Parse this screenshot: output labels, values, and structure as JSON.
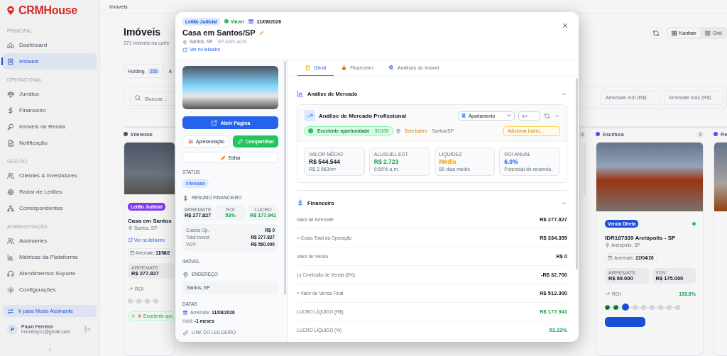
{
  "brand": {
    "name": "CRMHouse"
  },
  "sidebar": {
    "sections": [
      {
        "title": "PRINCIPAL",
        "items": [
          {
            "label": "Dashboard",
            "selected": false
          },
          {
            "label": "Imóveis",
            "selected": true
          }
        ]
      },
      {
        "title": "OPERACIONAL",
        "items": [
          {
            "label": "Jurídico",
            "selected": false
          },
          {
            "label": "Financeiro",
            "selected": false
          },
          {
            "label": "Imóveis de Renda",
            "selected": false
          },
          {
            "label": "Notificação",
            "selected": false
          }
        ]
      },
      {
        "title": "GESTÃO",
        "items": [
          {
            "label": "Clientes & Investidores",
            "selected": false
          },
          {
            "label": "Radar de Leilões",
            "selected": false
          },
          {
            "label": "Correspondentes",
            "selected": false
          }
        ]
      },
      {
        "title": "ADMINISTRAÇÃO",
        "items": [
          {
            "label": "Assinantes",
            "selected": false
          },
          {
            "label": "Métricas da Plataforma",
            "selected": false
          },
          {
            "label": "Atendimentos Suporte",
            "selected": false
          },
          {
            "label": "Configurações",
            "selected": false
          }
        ]
      }
    ],
    "mode_button": "Ir para Modo Assinante",
    "user": {
      "initial": "P",
      "name": "Paulo Ferreira",
      "email": "imoveispc1@gmail.com"
    }
  },
  "header": {
    "breadcrumb": "Imóveis"
  },
  "page": {
    "title": "Imóveis",
    "subtitle": "371 imóveis na carte",
    "view_toggle": [
      {
        "label": "Kanban",
        "selected": true
      },
      {
        "label": "Grid",
        "selected": false
      }
    ],
    "tabs": [
      {
        "label": "Holding",
        "count": "235",
        "selected": true
      },
      {
        "label": "A",
        "selected": false
      }
    ],
    "search": {
      "placeholder": "Buscar..."
    },
    "filters": [
      {
        "placeholder": "Arremate mín (R$)"
      },
      {
        "placeholder": "Arremate máx (R$)"
      }
    ]
  },
  "kanban": {
    "columns": [
      {
        "kind": "cards",
        "title": "Interesse",
        "color": "#475569",
        "card": {
          "badge": {
            "label": "Leilão Judicial",
            "color": "#7c3aed"
          },
          "title": "Casa em Santos",
          "location": "Santos, SP",
          "link": "Ver no leiloeiro",
          "date": "Arremate: **11/08/2**",
          "stats": [
            {
              "label": "ARREMATE",
              "value": "R$ 277.827"
            }
          ],
          "roi_label": "ROI",
          "steps": [
            {
              "done": false,
              "current": false
            },
            {
              "done": false,
              "current": false
            },
            {
              "done": false,
              "current": false
            },
            {
              "done": false,
              "current": false
            }
          ],
          "opportunity": "Excelente opo"
        }
      },
      {
        "kind": "count_only",
        "count": "4"
      },
      {
        "kind": "cards",
        "title": "Escritura",
        "count": "9",
        "color": "#7c3aed",
        "card": {
          "badge": {
            "label": "Venda Direta",
            "color": "#1d4ed8"
          },
          "status_dot": {
            "color": "#22c55e"
          },
          "title": "IDR187339 Areiópolis - SP",
          "location": "Areiópolis, SP",
          "date": "Arremate: **22/04/26**",
          "stats": [
            {
              "label": "ARREMATE",
              "value": "R$ 69.000"
            },
            {
              "label": "VGV",
              "value": "R$ 175.000"
            }
          ],
          "roi_label": "ROI",
          "roi_value": "153.6%",
          "steps": [
            {
              "done": true,
              "current": false
            },
            {
              "done": true,
              "current": false
            },
            {
              "done": false,
              "current": true
            },
            {
              "done": false,
              "current": false
            },
            {
              "done": false,
              "current": false
            },
            {
              "done": false,
              "current": false
            },
            {
              "done": false,
              "current": false
            },
            {
              "done": false,
              "current": false
            },
            {
              "done": false,
              "current": false
            }
          ],
          "button": true
        }
      },
      {
        "kind": "cards",
        "title": "Re",
        "color": "#7c3aed"
      }
    ]
  },
  "modal": {
    "type_badge": "Leilão Judicial",
    "viability": "Viável",
    "date": "11/08/2026",
    "title": "Casa em Santos/SP",
    "location": "Santos, SP",
    "code": "SP-SAN-ad7e",
    "link": "Ver no leiloeiro",
    "side": {
      "open_button": "Abrir Página",
      "presentation_button": "Apresentação",
      "share_button": "Compartilhar",
      "edit_button": "Editar",
      "status_title": "STATUS",
      "status": "Interesse",
      "finance_title": "RESUMO FINANCEIRO",
      "summary": [
        {
          "label": "ARREMATE",
          "value": "R$ 277.827",
          "color": "#111827"
        },
        {
          "label": "ROI",
          "value": "53%",
          "color": "#16a34a"
        },
        {
          "label": "LUCRO",
          "value": "R$ 177.941",
          "color": "#16a34a"
        }
      ],
      "details": [
        {
          "label": "Custos Op.",
          "value": "R$ 0"
        },
        {
          "label": "Total Invest.",
          "value": "R$ 277.827"
        },
        {
          "label": "VGV",
          "value": "R$ 560.000"
        }
      ],
      "property_title": "IMÓVEL",
      "address_title": "ENDEREÇO",
      "address": "Santos, SP",
      "dates_title": "DATAS",
      "dates": [
        "Arremate: **11/08/2026**",
        "Hold: **-1 meses**"
      ],
      "link_title": "LINK DO LEILOEIRO"
    },
    "tabs": [
      {
        "label": "Geral",
        "selected": true
      },
      {
        "label": "Financeiro",
        "selected": false
      },
      {
        "label": "Análises do Imóvel",
        "selected": false
      }
    ],
    "market": {
      "title": "Análise de Mercado",
      "card_title": "Análise de Mercado Profissional",
      "type_select": "Apartamento",
      "area_placeholder": "m²",
      "score": "Excelente oportunidade",
      "score_value": "· 92/100",
      "neighborhood": "Sem bairro",
      "city": "· Santos/SP",
      "neighborhood_placeholder": "Adicionar bairro...",
      "metrics": [
        {
          "label": "VALOR MÉDIO",
          "value": "R$ 544.544",
          "note": "R$ 2.063/m²",
          "color": "#111827"
        },
        {
          "label": "ALUGUEL EST.",
          "value": "R$ 2.723",
          "note": "0.50% a.m.",
          "color": "#16a34a"
        },
        {
          "label": "LIQUIDEZ",
          "value": "Média",
          "note": "80 dias médio",
          "color": "#f59e0b"
        },
        {
          "label": "ROI ANUAL",
          "value": "6.0%",
          "note": "Potencial de revenda",
          "color": "#2563eb"
        }
      ]
    },
    "finance": {
      "title": "Financeiro",
      "rows": [
        {
          "label": "Valor de Arremate",
          "value": "R$ 277.827",
          "color": "#111827"
        },
        {
          "label": "= Custo Total da Operação",
          "value": "R$ 334.359",
          "color": "#111827"
        },
        {
          "label": "Valor de Venda",
          "value": "R$ 0",
          "color": "#111827"
        },
        {
          "label": "(-) Comissão de Venda (6%)",
          "value": "-R$ 32.700",
          "color": "#111827"
        },
        {
          "label": "= Valor de Venda Final",
          "value": "R$ 512.300",
          "color": "#111827"
        },
        {
          "label": "LUCRO LÍQUIDO (R$)",
          "value": "R$ 177.941",
          "color": "#16a34a"
        },
        {
          "label": "LUCRO LÍQUIDO (%)",
          "value": "53.22%",
          "color": "#16a34a"
        }
      ]
    }
  }
}
